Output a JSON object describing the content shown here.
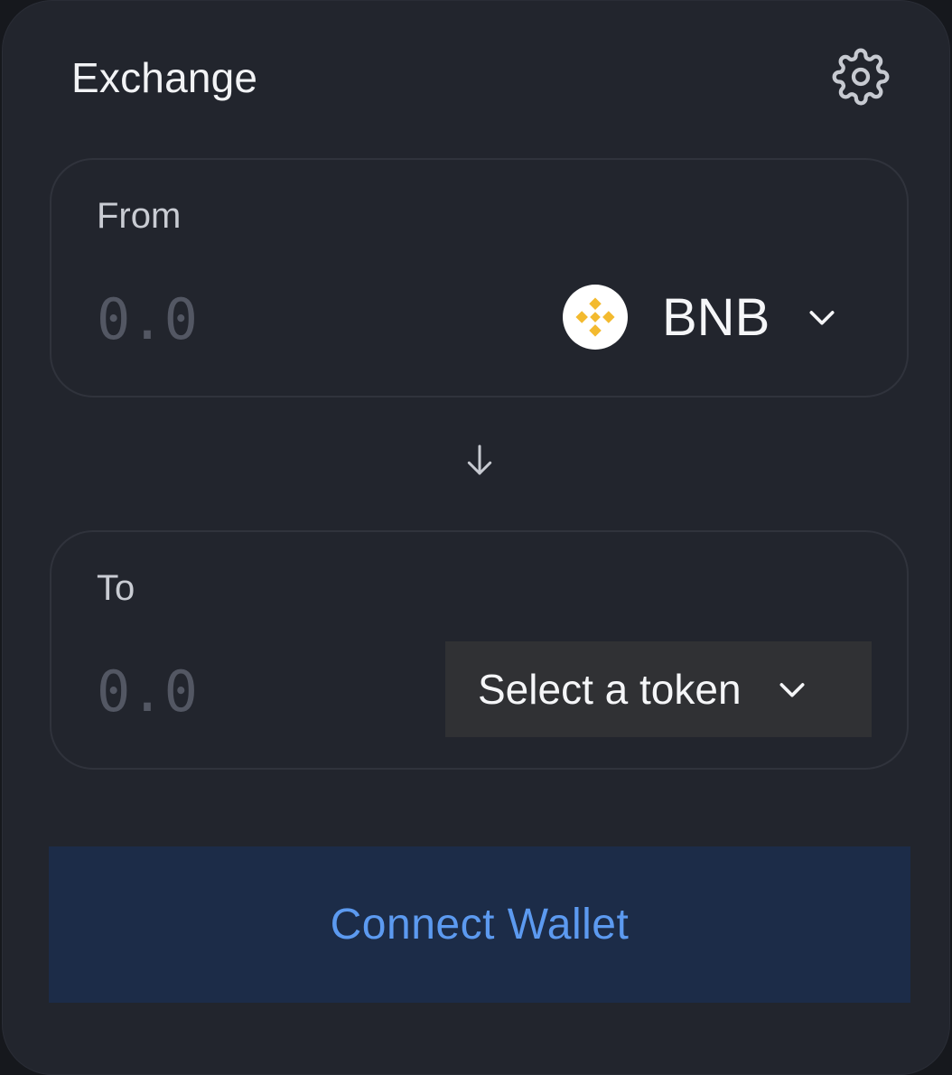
{
  "header": {
    "title": "Exchange",
    "settings_icon": "gear-icon"
  },
  "from": {
    "label": "From",
    "amount_placeholder": "0.0",
    "token": {
      "symbol": "BNB",
      "logo_icon": "bnb-logo-icon",
      "logo_color": "#F3BA2F"
    }
  },
  "swap": {
    "icon": "arrow-down-icon"
  },
  "to": {
    "label": "To",
    "amount_placeholder": "0.0",
    "select_label": "Select a token"
  },
  "connect": {
    "label": "Connect Wallet"
  },
  "colors": {
    "background": "#22252D",
    "accent": "#5C9AF0",
    "button_bg": "#1C2C48"
  }
}
